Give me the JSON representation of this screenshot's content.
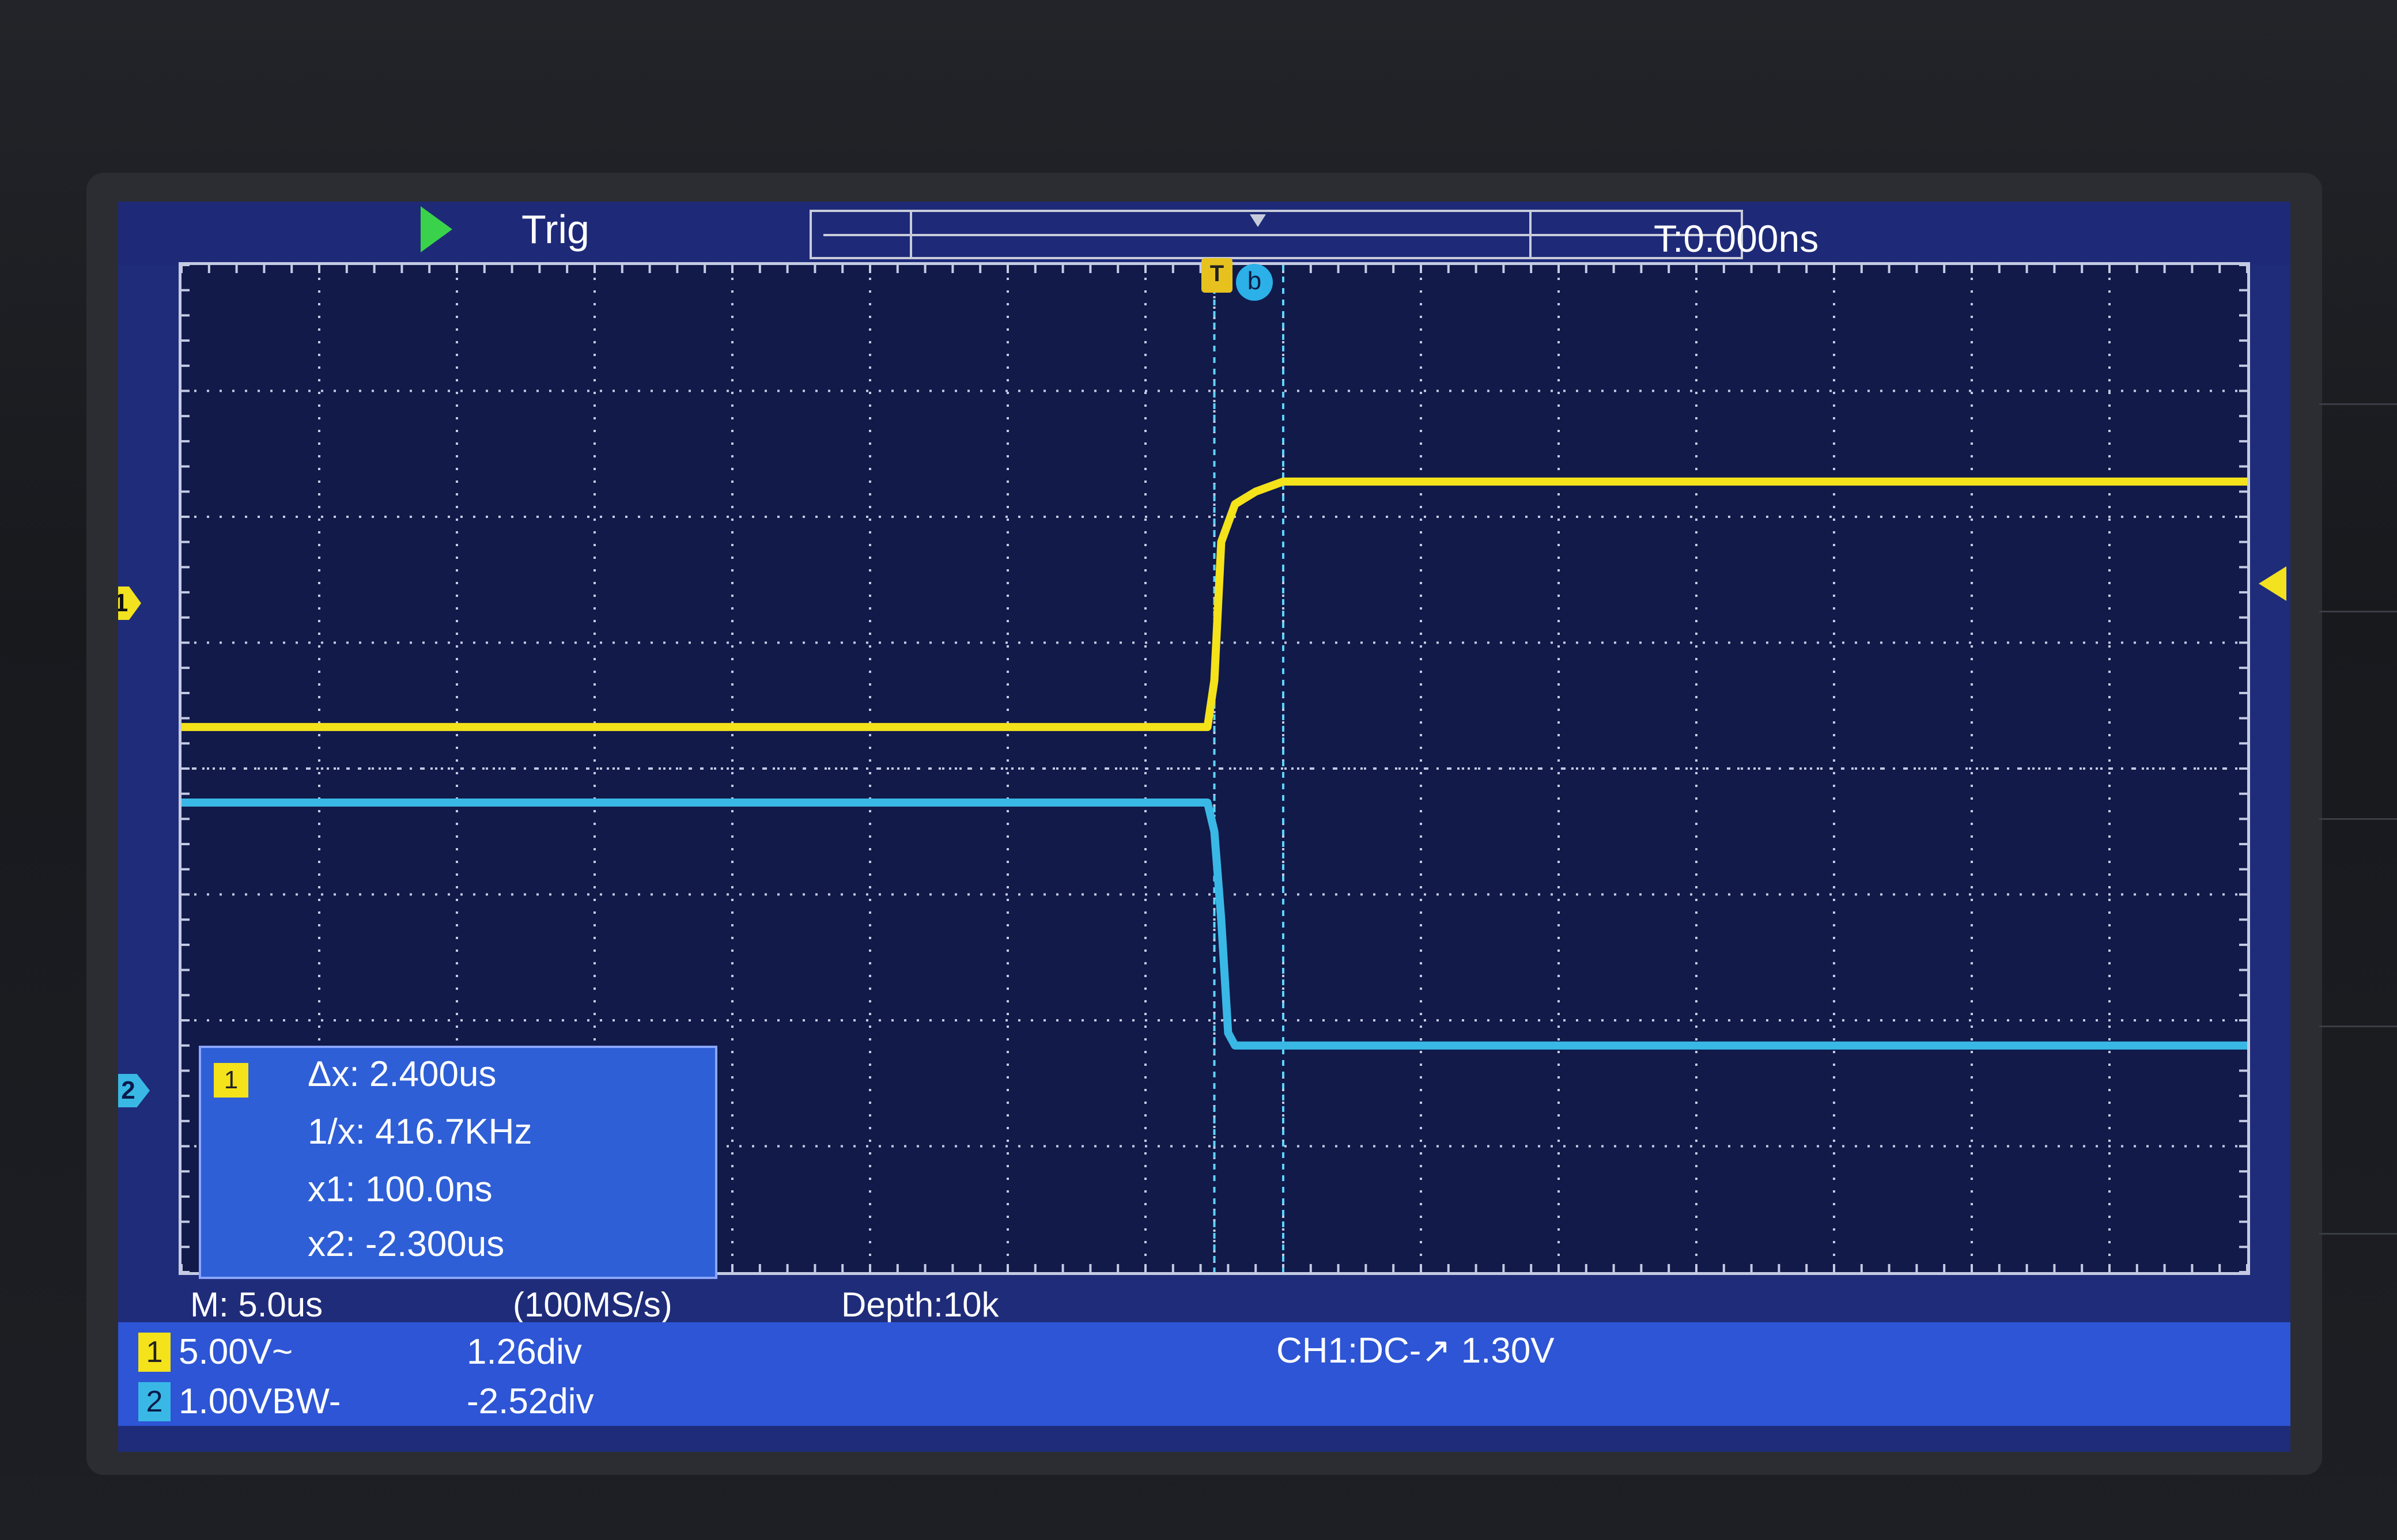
{
  "topbar": {
    "trigger_label": "Trig",
    "time_offset": "T:0.000ns"
  },
  "markers": {
    "ch1": "1",
    "ch2": "2",
    "trigger_point": "T",
    "cursor_b": "b"
  },
  "measurement": {
    "channel": "1",
    "delta_x": "Δx: 2.400us",
    "inverse_x": "1/x: 416.7KHz",
    "x1": "x1: 100.0ns",
    "x2": "x2: -2.300us"
  },
  "status": {
    "timebase": "M: 5.0us",
    "sample_rate": "(100MS/s)",
    "depth": "Depth:10k",
    "trigger_info": "CH1:DC-↗ 1.30V"
  },
  "channels": [
    {
      "num": "1",
      "scale": "5.00V~",
      "position": "1.26div",
      "color": "#f4e21a"
    },
    {
      "num": "2",
      "scale": "1.00VBW-",
      "position": "-2.52div",
      "color": "#39b8e6"
    }
  ],
  "chart_data": {
    "type": "line",
    "title": "",
    "xlabel": "",
    "ylabel": "",
    "x_divisions": 15,
    "y_divisions": 8,
    "series": [
      {
        "color": "#f4e21a",
        "x": [
          -7.5,
          -0.05,
          0.0,
          0.05,
          0.15,
          0.3,
          0.5,
          7.5
        ],
        "y": [
          0.33,
          0.33,
          0.7,
          1.8,
          2.1,
          2.2,
          2.28,
          2.28
        ]
      },
      {
        "color": "#39b8e6",
        "x": [
          -7.5,
          -0.05,
          0.0,
          0.05,
          0.1,
          0.15,
          7.5
        ],
        "y": [
          -0.27,
          -0.27,
          -0.5,
          -1.2,
          -2.1,
          -2.2,
          -2.2
        ]
      }
    ],
    "cursors": [
      {
        "x": 0.0
      },
      {
        "x": 0.5
      }
    ],
    "grid": true
  }
}
